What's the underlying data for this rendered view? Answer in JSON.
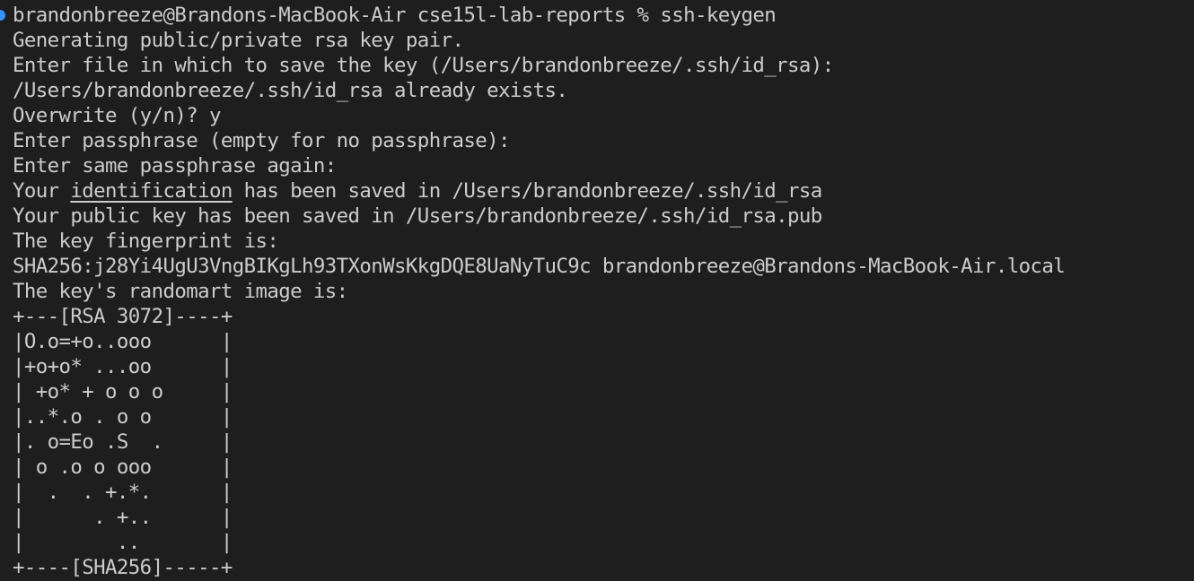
{
  "terminal": {
    "prompt": {
      "text": "brandonbreeze@Brandons-MacBook-Air cse15l-lab-reports % ",
      "command": "ssh-keygen"
    },
    "lines": {
      "generating": "Generating public/private rsa key pair.",
      "enter_file": "Enter file in which to save the key (/Users/brandonbreeze/.ssh/id_rsa):",
      "exists": "/Users/brandonbreeze/.ssh/id_rsa already exists.",
      "overwrite": "Overwrite (y/n)? y",
      "passphrase": "Enter passphrase (empty for no passphrase):",
      "passphrase_again": "Enter same passphrase again:",
      "saved_pre": "Your ",
      "saved_link": "identification",
      "saved_post": " has been saved in /Users/brandonbreeze/.ssh/id_rsa",
      "public_saved": "Your public key has been saved in /Users/brandonbreeze/.ssh/id_rsa.pub",
      "fingerprint_label": "The key fingerprint is:",
      "fingerprint": "SHA256:j28Yi4UgU3VngBIKgLh93TXonWsKkgDQE8UaNyTuC9c brandonbreeze@Brandons-MacBook-Air.local",
      "randomart_label": "The key's randomart image is:"
    },
    "randomart": [
      "+---[RSA 3072]----+",
      "|O.o=+o..ooo      |",
      "|+o+o* ...oo      |",
      "| +o* + o o o     |",
      "|..*.o . o o      |",
      "|. o=Eo .S  .     |",
      "| o .o o ooo      |",
      "|  .  . +.*.      |",
      "|      . +..      |",
      "|        ..       |",
      "+----[SHA256]-----+"
    ],
    "colors": {
      "background": "#1e1e1e",
      "foreground": "#cccccc",
      "prompt_marker": "#3794ff"
    }
  }
}
